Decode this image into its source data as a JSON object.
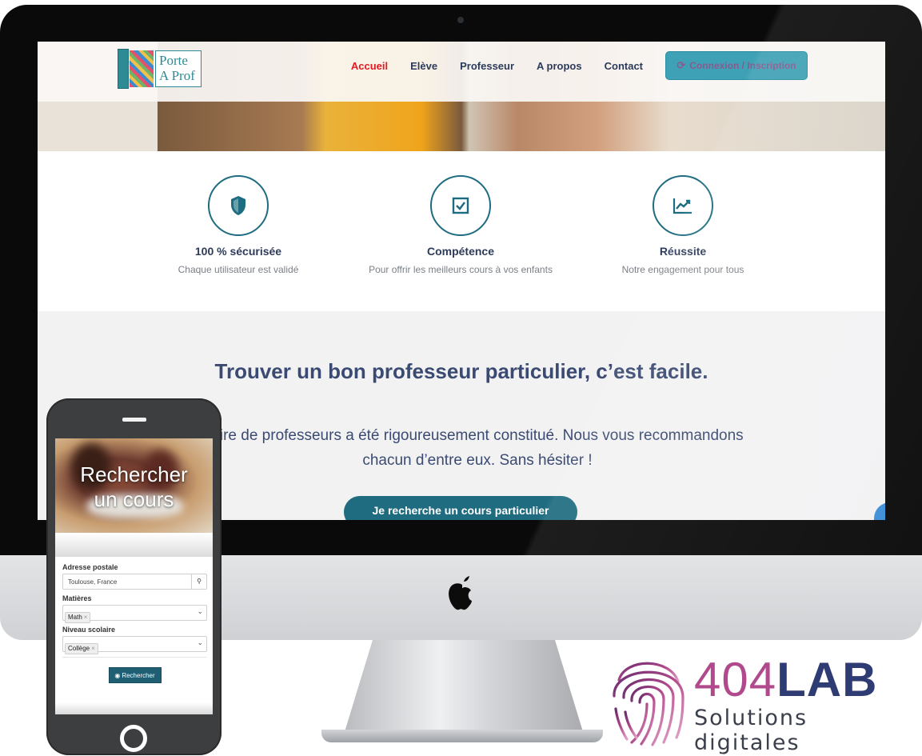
{
  "site": {
    "logo": {
      "line1": "Porte",
      "line2": "A Prof"
    },
    "nav": {
      "items": [
        "Accueil",
        "Elève",
        "Professeur",
        "A propos",
        "Contact"
      ],
      "active": "Accueil",
      "cta_label": "Connexion / Inscription",
      "cta_icon": "refresh-icon"
    },
    "features": [
      {
        "icon": "shield-icon",
        "title": "100 % sécurisée",
        "subtitle": "Chaque utilisateur est validé"
      },
      {
        "icon": "check-square-icon",
        "title": "Compétence",
        "subtitle": "Pour offrir les meilleurs cours à vos enfants"
      },
      {
        "icon": "trend-chart-icon",
        "title": "Réussite",
        "subtitle": "Notre engagement pour tous"
      }
    ],
    "section": {
      "title": "Trouver un bon professeur particulier, c’est facile.",
      "text_line1": "aire de professeurs a été rigoureusement constitué. Nous vous recommandons",
      "text_line2": "chacun d’entre eux. Sans hésiter !",
      "button": "Je recherche un cours particulier"
    },
    "colors": {
      "accent": "#1f6c80",
      "active_nav": "#e31b23",
      "heading": "#3a4a72"
    }
  },
  "mobile": {
    "hero_title_line1": "Rechercher",
    "hero_title_line2": "un cours",
    "form": {
      "address_label": "Adresse postale",
      "address_value": "Toulouse, France",
      "address_icon": "map-marker-icon",
      "subjects_label": "Matières",
      "subjects_tag": "Math",
      "level_label": "Niveau scolaire",
      "level_tag": "Collège",
      "tag_remove": "×",
      "submit": "Rechercher",
      "submit_icon": "eye-icon"
    }
  },
  "brand": {
    "name_part1": "404",
    "name_part2": "LAB",
    "tagline": "Solutions digitales",
    "colors": {
      "purple": "#b14a8c",
      "navy": "#2f3b73"
    }
  }
}
